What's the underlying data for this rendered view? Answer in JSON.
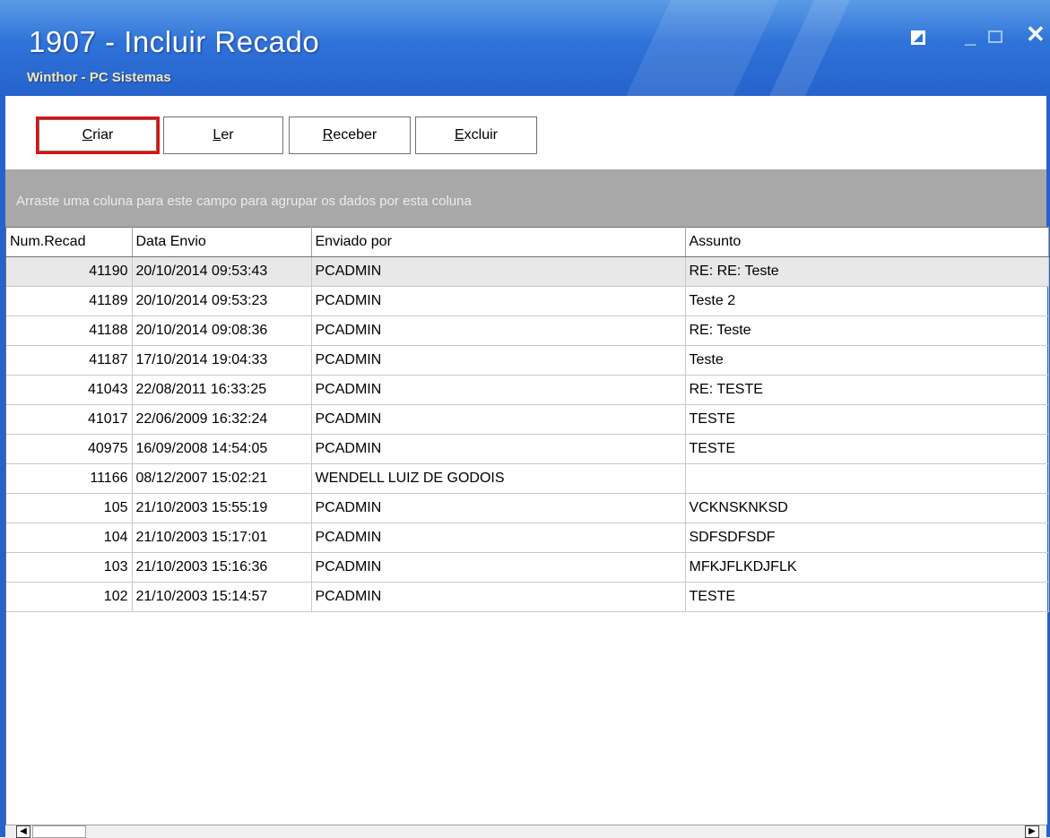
{
  "window": {
    "title": "1907 - Incluir Recado",
    "subtitle": "Winthor - PC Sistemas",
    "controls": {
      "tile_icon": "tile-icon",
      "minimize_glyph": "_",
      "close_glyph": "✕"
    }
  },
  "toolbar": {
    "criar": {
      "accel": "C",
      "rest": "riar"
    },
    "ler": {
      "accel": "L",
      "rest": "er"
    },
    "receber": {
      "accel": "R",
      "rest": "eceber"
    },
    "excluir": {
      "accel": "E",
      "rest": "xcluir"
    }
  },
  "grid": {
    "group_hint": "Arraste uma coluna para este campo para agrupar os dados por esta coluna",
    "columns": [
      "Num.Recad",
      "Data Envio",
      "Enviado por",
      "Assunto"
    ],
    "rows": [
      {
        "num": "41190",
        "data": "20/10/2014 09:53:43",
        "enviado": "PCADMIN",
        "assunto": "RE: RE: Teste"
      },
      {
        "num": "41189",
        "data": "20/10/2014 09:53:23",
        "enviado": "PCADMIN",
        "assunto": "Teste 2"
      },
      {
        "num": "41188",
        "data": "20/10/2014 09:08:36",
        "enviado": "PCADMIN",
        "assunto": "RE: Teste"
      },
      {
        "num": "41187",
        "data": "17/10/2014 19:04:33",
        "enviado": "PCADMIN",
        "assunto": "Teste"
      },
      {
        "num": "41043",
        "data": "22/08/2011 16:33:25",
        "enviado": "PCADMIN",
        "assunto": "RE: TESTE"
      },
      {
        "num": "41017",
        "data": "22/06/2009 16:32:24",
        "enviado": "PCADMIN",
        "assunto": "TESTE"
      },
      {
        "num": "40975",
        "data": "16/09/2008 14:54:05",
        "enviado": "PCADMIN",
        "assunto": "TESTE"
      },
      {
        "num": "11166",
        "data": "08/12/2007 15:02:21",
        "enviado": "WENDELL LUIZ DE GODOIS",
        "assunto": ""
      },
      {
        "num": "105",
        "data": "21/10/2003 15:55:19",
        "enviado": "PCADMIN",
        "assunto": "VCKNSKNKSD"
      },
      {
        "num": "104",
        "data": "21/10/2003 15:17:01",
        "enviado": "PCADMIN",
        "assunto": "SDFSDFSDF"
      },
      {
        "num": "103",
        "data": "21/10/2003 15:16:36",
        "enviado": "PCADMIN",
        "assunto": "MFKJFLKDJFLK"
      },
      {
        "num": "102",
        "data": "21/10/2003 15:14:57",
        "enviado": "PCADMIN",
        "assunto": "TESTE"
      }
    ]
  },
  "scrollbar": {
    "left_glyph": "◀",
    "right_glyph": "▶"
  }
}
